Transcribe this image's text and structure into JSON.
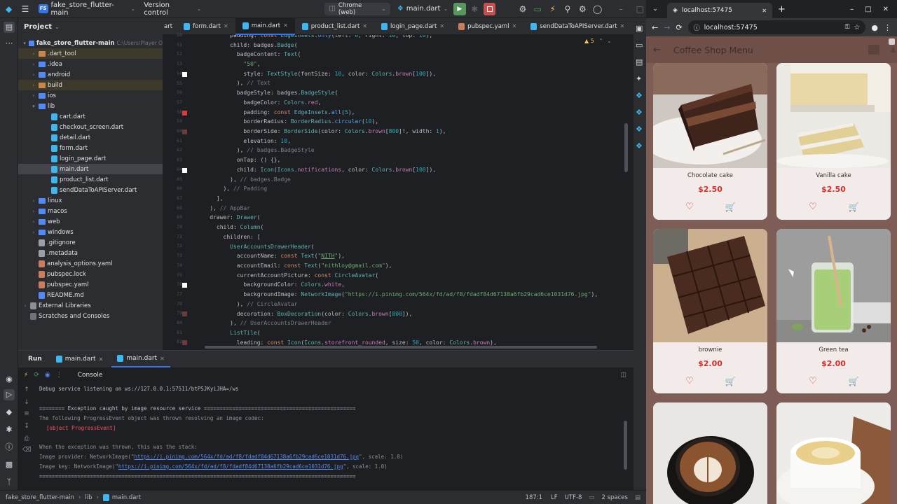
{
  "topbar": {
    "project_badge": "FS",
    "project_name": "fake_store_flutter-main",
    "vcs": "Version control",
    "device": "Chrome (web)",
    "run_config": "main.dart"
  },
  "project_panel": {
    "title": "Project",
    "root_name": "fake_store_flutter-main",
    "root_path": "C:\\Users\\Player O",
    "items": [
      {
        "label": ".dart_tool",
        "kind": "folder-orange"
      },
      {
        "label": ".idea",
        "kind": "folder"
      },
      {
        "label": "android",
        "kind": "folder"
      },
      {
        "label": "build",
        "kind": "folder-orange"
      },
      {
        "label": "ios",
        "kind": "folder"
      },
      {
        "label": "lib",
        "kind": "folder"
      },
      {
        "label": "cart.dart",
        "kind": "dart"
      },
      {
        "label": "checkout_screen.dart",
        "kind": "dart"
      },
      {
        "label": "detail.dart",
        "kind": "dart"
      },
      {
        "label": "form.dart",
        "kind": "dart"
      },
      {
        "label": "login_page.dart",
        "kind": "dart"
      },
      {
        "label": "main.dart",
        "kind": "dart"
      },
      {
        "label": "product_list.dart",
        "kind": "dart"
      },
      {
        "label": "sendDataToAPIServer.dart",
        "kind": "dart"
      },
      {
        "label": "linux",
        "kind": "folder"
      },
      {
        "label": "macos",
        "kind": "folder"
      },
      {
        "label": "web",
        "kind": "folder"
      },
      {
        "label": "windows",
        "kind": "folder"
      },
      {
        "label": ".gitignore",
        "kind": "file"
      },
      {
        "label": ".metadata",
        "kind": "file"
      },
      {
        "label": "analysis_options.yaml",
        "kind": "yaml"
      },
      {
        "label": "pubspec.lock",
        "kind": "yaml"
      },
      {
        "label": "pubspec.yaml",
        "kind": "yaml"
      },
      {
        "label": "README.md",
        "kind": "md"
      },
      {
        "label": "External Libraries",
        "kind": "lib"
      },
      {
        "label": "Scratches and Consoles",
        "kind": "scratch"
      }
    ]
  },
  "editor": {
    "tabs": [
      {
        "label": "art"
      },
      {
        "label": "form.dart"
      },
      {
        "label": "main.dart"
      },
      {
        "label": "product_list.dart"
      },
      {
        "label": "login_page.dart"
      },
      {
        "label": "pubspec.yaml"
      },
      {
        "label": "sendDataToAPIServer.dart"
      }
    ],
    "warnings": "5",
    "line_numbers": [
      "50",
      "51",
      "52",
      "53",
      "54",
      "55",
      "56",
      "57",
      "58",
      "59",
      "60",
      "61",
      "62",
      "63",
      "64",
      "65",
      "66",
      "67",
      "68",
      "69",
      "70",
      "71",
      "72",
      "73",
      "74",
      "75",
      "76",
      "77",
      "78",
      "79",
      "80",
      "81",
      "82"
    ]
  },
  "run_panel": {
    "run_label": "Run",
    "tab1": "main.dart",
    "tab2": "main.dart",
    "console_label": "Console",
    "lines": {
      "l1": "Debug service listening on ws://127.0.0.1:57511/btPSJKyiJHA=/ws",
      "l2": "======== Exception caught by image resource service ================================================",
      "l3": "The following ProgressEvent object was thrown resolving an image codec:",
      "l4": "[object ProgressEvent]",
      "l5": "When the exception was thrown, this was the stack:",
      "l6a": "Image provider: NetworkImage(\"",
      "l6b": "https://i.pinimg.com/564x/fd/ad/f8/fdadf84d67138a6fb29cad6ce1031d76.jpg",
      "l6c": "\", scale: 1.0)",
      "l7a": "Image key: NetworkImage(\"",
      "l7b": "https://i.pinimg.com/564x/fd/ad/f8/fdadf84d67138a6fb29cad6ce1031d76.jpg",
      "l7c": "\", scale: 1.0)",
      "l8": "===================================================================================================="
    }
  },
  "statusbar": {
    "project": "fake_store_flutter-main",
    "folder": "lib",
    "file": "main.dart",
    "position": "187:1",
    "line_sep": "LF",
    "encoding": "UTF-8",
    "indent": "2 spaces"
  },
  "browser": {
    "tab_title": "localhost:57475",
    "url": "localhost:57475"
  },
  "app": {
    "title": "Coffee Shop Menu",
    "products": [
      {
        "name": "Chocolate cake",
        "price": "$2.50"
      },
      {
        "name": "Vanilla cake",
        "price": "$2.50"
      },
      {
        "name": "brownie",
        "price": "$2.00"
      },
      {
        "name": "Green tea",
        "price": "$2.00"
      }
    ]
  },
  "colors": {
    "ide_bg": "#1e1f22",
    "app_bg": "#7d5d55",
    "price": "#d5302c",
    "cart": "#e2901a"
  }
}
